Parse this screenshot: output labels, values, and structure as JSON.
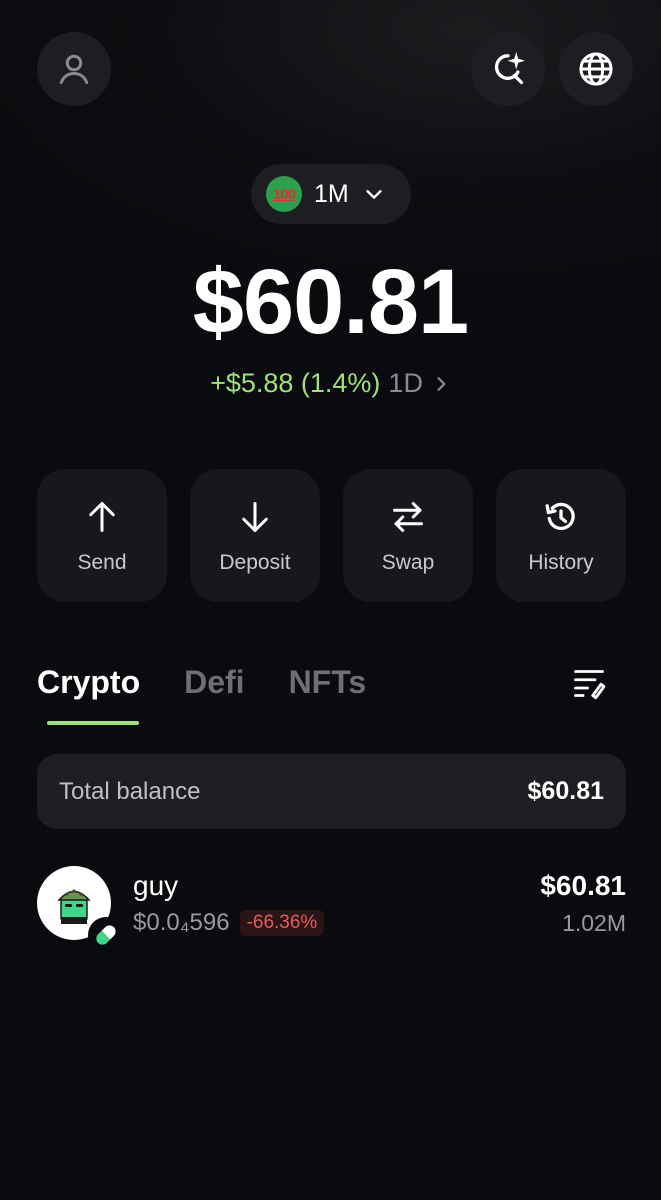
{
  "header": {
    "profile_icon": "user-icon",
    "ai_search_icon": "sparkle-search-icon",
    "globe_icon": "globe-icon"
  },
  "account": {
    "emoji": "100-emoji-icon",
    "label": "1M"
  },
  "portfolio": {
    "balance": "$60.81",
    "change": "+$5.88 (1.4%)",
    "period": "1D"
  },
  "actions": [
    {
      "label": "Send",
      "icon": "arrow-up-icon"
    },
    {
      "label": "Deposit",
      "icon": "arrow-down-icon"
    },
    {
      "label": "Swap",
      "icon": "swap-arrows-icon"
    },
    {
      "label": "History",
      "icon": "history-icon"
    }
  ],
  "tabs": [
    {
      "label": "Crypto",
      "active": true
    },
    {
      "label": "Defi",
      "active": false
    },
    {
      "label": "NFTs",
      "active": false
    }
  ],
  "total": {
    "label": "Total balance",
    "value": "$60.81"
  },
  "tokens": [
    {
      "name": "guy",
      "price": "$0.0₄596",
      "change": "-66.36%",
      "value": "$60.81",
      "amount": "1.02M",
      "chain_icon": "pill-icon"
    }
  ],
  "colors": {
    "accent_green": "#9ee079",
    "negative_red": "#e85a5a",
    "background": "#0a0b0e",
    "card": "#1d1e21"
  }
}
